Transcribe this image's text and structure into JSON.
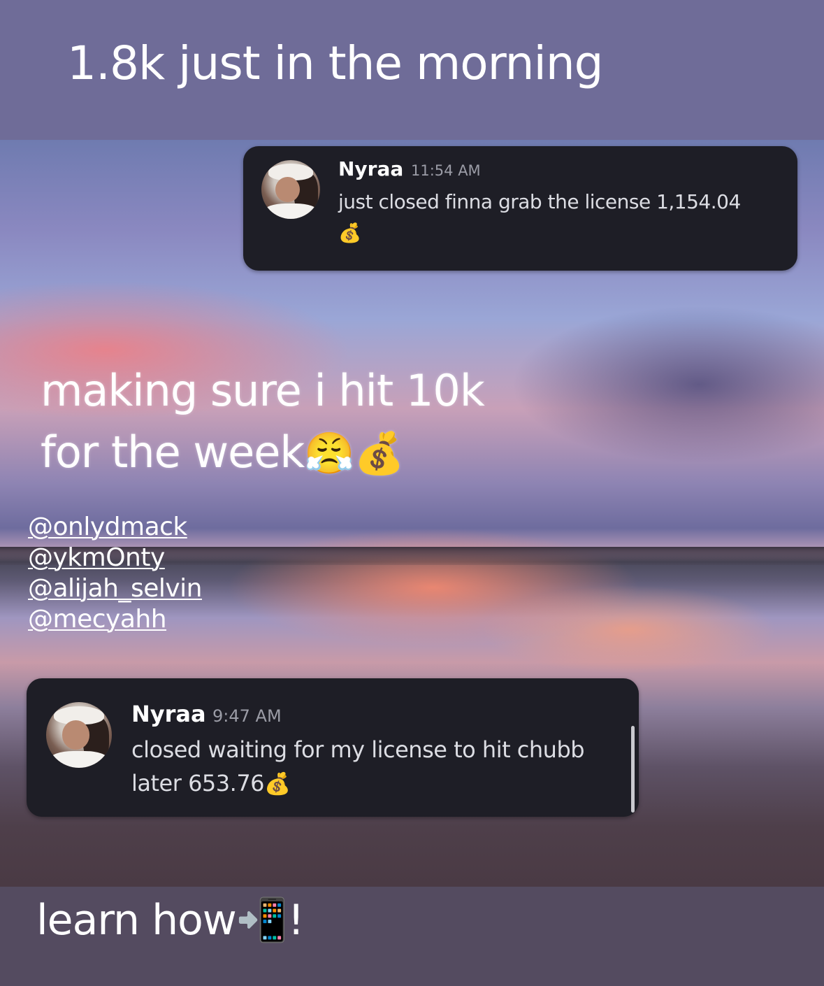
{
  "headline": "1.8k just in the morning",
  "caption": {
    "line1": "making sure i hit 10k",
    "line2": "for the week",
    "emojis": "😤💰"
  },
  "mentions": [
    "@onlydmack",
    "@ykmOnty",
    "@alijah_selvin",
    "@mecyahh"
  ],
  "messages": [
    {
      "username": "Nyraa",
      "time": "11:54 AM",
      "text": "just closed finna grab the license  1,154.04",
      "emoji": "💰",
      "avatar_icon": "profile-photo"
    },
    {
      "username": "Nyraa",
      "time": "9:47 AM",
      "text": "closed waiting for my license to hit chubb later 653.76",
      "emoji": "💰",
      "avatar_icon": "profile-photo"
    }
  ],
  "footer": {
    "text": "learn how",
    "emoji": "📲!"
  },
  "colors": {
    "top_band": "#6f6c98",
    "bottom_band": "#544b60",
    "card_background": "#1e1e26",
    "timestamp": "#9b9ca6"
  }
}
